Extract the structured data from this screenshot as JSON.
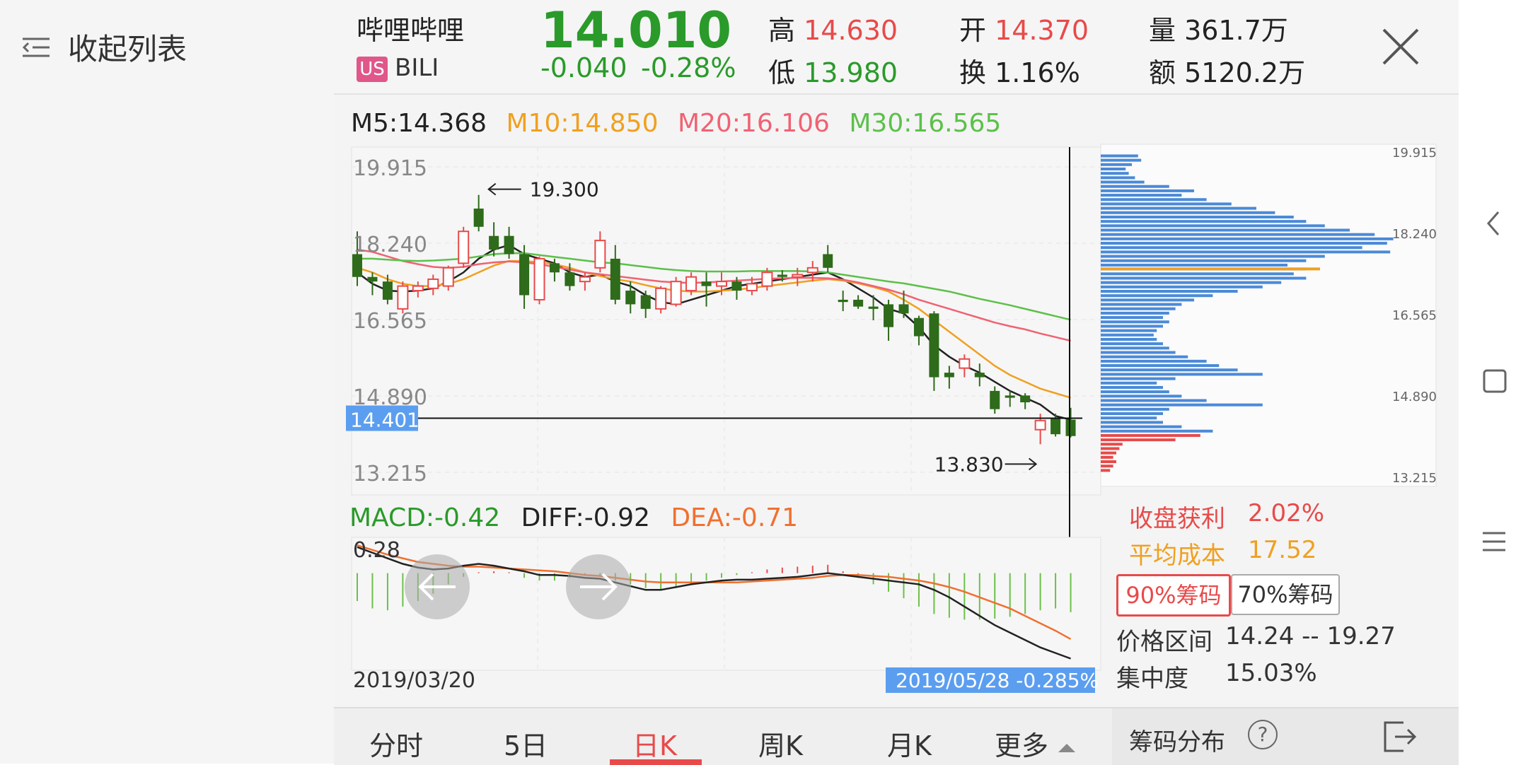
{
  "left_panel": {
    "collapse_label": "收起列表"
  },
  "stock": {
    "name": "哔哩哔哩",
    "market_badge": "US",
    "ticker": "BILI",
    "price": "14.010",
    "change": "-0.040",
    "change_pct": "-0.28%",
    "high_label": "高",
    "high": "14.630",
    "low_label": "低",
    "low": "13.980",
    "open_label": "开",
    "open": "14.370",
    "turnover_label": "换",
    "turnover": "1.16%",
    "volume_label": "量",
    "volume": "361.7万",
    "amount_label": "额",
    "amount": "5120.2万"
  },
  "ma_legend": {
    "m5": "M5:14.368",
    "m10": "M10:14.850",
    "m20": "M20:16.106",
    "m30": "M30:16.565"
  },
  "macd_legend": {
    "macd": "MACD:-0.42",
    "diff": "DIFF:-0.92",
    "dea": "DEA:-0.71"
  },
  "colors": {
    "up": "#e84a4a",
    "down": "#2e6b1a",
    "m5": "#222222",
    "m10": "#f0a020",
    "m20": "#ef6373",
    "m30": "#5cc04a",
    "chip_blue": "#4a8ad8",
    "chip_red": "#e84a4a",
    "accent": "#e84a4a"
  },
  "chart_data": [
    {
      "type": "candlestick",
      "ylim": [
        13.215,
        19.915
      ],
      "yticks": [
        "19.915",
        "18.240",
        "16.565",
        "14.890",
        "13.215"
      ],
      "crosshair_price": "14.401",
      "annotations": {
        "high": "19.300",
        "low": "13.830"
      },
      "candles": [
        [
          18.0,
          18.5,
          17.3,
          17.5
        ],
        [
          17.5,
          17.6,
          17.1,
          17.4
        ],
        [
          17.4,
          17.55,
          16.9,
          17.0
        ],
        [
          16.8,
          17.4,
          16.7,
          17.3
        ],
        [
          17.2,
          17.4,
          17.05,
          17.3
        ],
        [
          17.25,
          17.55,
          17.1,
          17.45
        ],
        [
          17.3,
          17.75,
          17.2,
          17.7
        ],
        [
          17.8,
          18.6,
          17.7,
          18.5
        ],
        [
          19.0,
          19.3,
          18.5,
          18.6
        ],
        [
          18.4,
          18.7,
          17.95,
          18.1
        ],
        [
          18.4,
          18.6,
          17.9,
          18.0
        ],
        [
          18.0,
          18.2,
          16.8,
          17.1
        ],
        [
          17.0,
          17.95,
          16.9,
          17.9
        ],
        [
          17.8,
          17.9,
          17.4,
          17.6
        ],
        [
          17.6,
          17.8,
          17.2,
          17.3
        ],
        [
          17.4,
          17.6,
          17.2,
          17.5
        ],
        [
          17.7,
          18.5,
          17.6,
          18.3
        ],
        [
          17.9,
          18.2,
          16.9,
          17.0
        ],
        [
          17.2,
          17.4,
          16.7,
          16.9
        ],
        [
          17.1,
          17.2,
          16.6,
          16.8
        ],
        [
          16.8,
          17.3,
          16.7,
          17.25
        ],
        [
          16.9,
          17.5,
          16.85,
          17.4
        ],
        [
          17.2,
          17.6,
          17.1,
          17.5
        ],
        [
          17.4,
          17.6,
          16.85,
          17.3
        ],
        [
          17.3,
          17.6,
          17.1,
          17.4
        ],
        [
          17.4,
          17.5,
          17.0,
          17.2
        ],
        [
          17.2,
          17.5,
          17.1,
          17.35
        ],
        [
          17.3,
          17.7,
          17.2,
          17.6
        ],
        [
          17.55,
          17.65,
          17.4,
          17.5
        ],
        [
          17.5,
          17.7,
          17.3,
          17.55
        ],
        [
          17.6,
          17.85,
          17.4,
          17.7
        ],
        [
          18.0,
          18.2,
          17.6,
          17.7
        ],
        [
          17.0,
          17.2,
          16.75,
          16.95
        ],
        [
          17.0,
          17.1,
          16.8,
          16.85
        ],
        [
          16.85,
          17.1,
          16.55,
          16.8
        ],
        [
          16.9,
          17.0,
          16.1,
          16.4
        ],
        [
          16.9,
          17.2,
          16.6,
          16.7
        ],
        [
          16.6,
          16.65,
          16.0,
          16.2
        ],
        [
          16.7,
          16.75,
          15.0,
          15.3
        ],
        [
          15.4,
          15.55,
          15.05,
          15.3
        ],
        [
          15.5,
          15.8,
          15.3,
          15.7
        ],
        [
          15.4,
          15.6,
          15.1,
          15.3
        ],
        [
          15.0,
          15.1,
          14.5,
          14.6
        ],
        [
          14.9,
          15.0,
          14.65,
          14.85
        ],
        [
          14.9,
          14.95,
          14.6,
          14.75
        ],
        [
          14.15,
          14.5,
          13.83,
          14.35
        ],
        [
          14.4,
          14.5,
          14.0,
          14.05
        ],
        [
          14.37,
          14.63,
          13.98,
          14.01
        ]
      ],
      "ma_lines": {
        "m5": [
          17.6,
          17.35,
          17.2,
          17.18,
          17.2,
          17.25,
          17.4,
          17.6,
          17.9,
          18.1,
          18.2,
          18.0,
          17.9,
          17.8,
          17.6,
          17.5,
          17.55,
          17.4,
          17.3,
          17.1,
          16.95,
          16.9,
          17.0,
          17.1,
          17.2,
          17.3,
          17.35,
          17.4,
          17.45,
          17.5,
          17.55,
          17.6,
          17.45,
          17.25,
          17.05,
          16.8,
          16.7,
          16.4,
          16.0,
          15.75,
          15.55,
          15.4,
          15.2,
          15.0,
          14.85,
          14.7,
          14.45,
          14.37
        ],
        "m10": [
          17.7,
          17.6,
          17.45,
          17.35,
          17.3,
          17.3,
          17.35,
          17.45,
          17.6,
          17.75,
          17.85,
          17.85,
          17.82,
          17.78,
          17.7,
          17.6,
          17.52,
          17.45,
          17.4,
          17.32,
          17.25,
          17.2,
          17.18,
          17.18,
          17.2,
          17.22,
          17.26,
          17.3,
          17.34,
          17.38,
          17.42,
          17.45,
          17.42,
          17.36,
          17.28,
          17.18,
          17.0,
          16.8,
          16.55,
          16.3,
          16.05,
          15.8,
          15.55,
          15.35,
          15.2,
          15.05,
          14.95,
          14.85
        ],
        "m20": [
          18.1,
          18.05,
          17.95,
          17.85,
          17.78,
          17.72,
          17.7,
          17.72,
          17.78,
          17.82,
          17.84,
          17.82,
          17.78,
          17.72,
          17.66,
          17.6,
          17.56,
          17.52,
          17.48,
          17.44,
          17.4,
          17.38,
          17.37,
          17.38,
          17.4,
          17.42,
          17.44,
          17.46,
          17.47,
          17.48,
          17.48,
          17.47,
          17.44,
          17.38,
          17.3,
          17.22,
          17.12,
          17.0,
          16.9,
          16.8,
          16.7,
          16.6,
          16.5,
          16.42,
          16.35,
          16.26,
          16.18,
          16.1
        ],
        "m30": [
          17.9,
          17.9,
          17.88,
          17.86,
          17.85,
          17.86,
          17.88,
          17.9,
          17.95,
          18.0,
          18.02,
          18.02,
          17.98,
          17.94,
          17.9,
          17.86,
          17.82,
          17.8,
          17.76,
          17.72,
          17.68,
          17.65,
          17.63,
          17.62,
          17.62,
          17.62,
          17.63,
          17.63,
          17.63,
          17.63,
          17.62,
          17.6,
          17.55,
          17.5,
          17.45,
          17.4,
          17.36,
          17.3,
          17.24,
          17.18,
          17.1,
          17.02,
          16.95,
          16.88,
          16.8,
          16.72,
          16.64,
          16.56
        ]
      }
    },
    {
      "type": "bar",
      "title": "MACD",
      "ytick": "0.28",
      "x_start": "2019/03/20",
      "x_end": "2019/05/28",
      "end_label": "-0.285%",
      "hist": [
        -0.3,
        -0.38,
        -0.4,
        -0.36,
        -0.3,
        -0.22,
        -0.12,
        -0.04,
        0.01,
        0.02,
        0.01,
        -0.05,
        -0.08,
        -0.08,
        -0.05,
        -0.03,
        -0.04,
        -0.08,
        -0.12,
        -0.16,
        -0.18,
        -0.16,
        -0.12,
        -0.08,
        -0.05,
        -0.02,
        0.01,
        0.04,
        0.06,
        0.07,
        0.08,
        0.09,
        0.02,
        -0.05,
        -0.12,
        -0.2,
        -0.27,
        -0.36,
        -0.44,
        -0.48,
        -0.5,
        -0.5,
        -0.49,
        -0.47,
        -0.44,
        -0.4,
        -0.38,
        -0.42
      ],
      "diff": [
        0.28,
        0.22,
        0.16,
        0.1,
        0.06,
        0.04,
        0.05,
        0.08,
        0.1,
        0.08,
        0.05,
        0.02,
        -0.02,
        -0.02,
        -0.03,
        -0.05,
        -0.06,
        -0.1,
        -0.14,
        -0.18,
        -0.18,
        -0.15,
        -0.12,
        -0.1,
        -0.08,
        -0.07,
        -0.07,
        -0.06,
        -0.05,
        -0.04,
        -0.02,
        0.0,
        -0.02,
        -0.04,
        -0.06,
        -0.08,
        -0.1,
        -0.12,
        -0.18,
        -0.26,
        -0.36,
        -0.46,
        -0.56,
        -0.64,
        -0.72,
        -0.8,
        -0.86,
        -0.92
      ],
      "dea": [
        0.3,
        0.25,
        0.2,
        0.16,
        0.12,
        0.1,
        0.08,
        0.07,
        0.07,
        0.06,
        0.05,
        0.04,
        0.03,
        0.02,
        0.0,
        -0.02,
        -0.03,
        -0.05,
        -0.07,
        -0.09,
        -0.1,
        -0.1,
        -0.1,
        -0.1,
        -0.1,
        -0.1,
        -0.09,
        -0.08,
        -0.07,
        -0.06,
        -0.05,
        -0.03,
        -0.02,
        -0.02,
        -0.03,
        -0.04,
        -0.06,
        -0.08,
        -0.11,
        -0.15,
        -0.2,
        -0.26,
        -0.32,
        -0.38,
        -0.46,
        -0.54,
        -0.62,
        -0.71
      ]
    },
    {
      "type": "horizontal-bar",
      "title": "筹码分布",
      "price_ticks": [
        "19.915",
        "18.240",
        "16.565",
        "14.890",
        "13.215"
      ],
      "ylim": [
        13.215,
        19.915
      ],
      "avg_cost": 17.52,
      "bins": [
        [
          19.85,
          0.12
        ],
        [
          19.76,
          0.13
        ],
        [
          19.67,
          0.1
        ],
        [
          19.58,
          0.08
        ],
        [
          19.49,
          0.09
        ],
        [
          19.4,
          0.11
        ],
        [
          19.31,
          0.14
        ],
        [
          19.22,
          0.22
        ],
        [
          19.13,
          0.3
        ],
        [
          19.04,
          0.26
        ],
        [
          18.95,
          0.34
        ],
        [
          18.86,
          0.42
        ],
        [
          18.77,
          0.5
        ],
        [
          18.68,
          0.56
        ],
        [
          18.59,
          0.62
        ],
        [
          18.5,
          0.66
        ],
        [
          18.41,
          0.72
        ],
        [
          18.32,
          0.8
        ],
        [
          18.23,
          0.88
        ],
        [
          18.14,
          0.94
        ],
        [
          18.05,
          0.92
        ],
        [
          17.96,
          0.84
        ],
        [
          17.87,
          0.93
        ],
        [
          17.78,
          0.72
        ],
        [
          17.69,
          0.66
        ],
        [
          17.6,
          0.6
        ],
        [
          17.52,
          0.66
        ],
        [
          17.42,
          0.62
        ],
        [
          17.33,
          0.66
        ],
        [
          17.24,
          0.58
        ],
        [
          17.15,
          0.52
        ],
        [
          17.06,
          0.44
        ],
        [
          16.97,
          0.36
        ],
        [
          16.88,
          0.3
        ],
        [
          16.79,
          0.26
        ],
        [
          16.7,
          0.24
        ],
        [
          16.61,
          0.22
        ],
        [
          16.52,
          0.2
        ],
        [
          16.43,
          0.22
        ],
        [
          16.34,
          0.2
        ],
        [
          16.25,
          0.18
        ],
        [
          16.16,
          0.17
        ],
        [
          16.07,
          0.18
        ],
        [
          15.98,
          0.2
        ],
        [
          15.89,
          0.22
        ],
        [
          15.8,
          0.24
        ],
        [
          15.71,
          0.28
        ],
        [
          15.62,
          0.34
        ],
        [
          15.53,
          0.38
        ],
        [
          15.44,
          0.44
        ],
        [
          15.35,
          0.52
        ],
        [
          15.26,
          0.24
        ],
        [
          15.17,
          0.18
        ],
        [
          15.08,
          0.2
        ],
        [
          14.99,
          0.22
        ],
        [
          14.9,
          0.26
        ],
        [
          14.81,
          0.34
        ],
        [
          14.72,
          0.52
        ],
        [
          14.63,
          0.22
        ],
        [
          14.54,
          0.2
        ],
        [
          14.45,
          0.18
        ],
        [
          14.36,
          0.2
        ],
        [
          14.27,
          0.26
        ],
        [
          14.18,
          0.36
        ],
        [
          14.09,
          0.32
        ],
        [
          14.0,
          0.24
        ],
        [
          13.91,
          0.07
        ],
        [
          13.82,
          0.06
        ],
        [
          13.73,
          0.05
        ],
        [
          13.64,
          0.04
        ],
        [
          13.55,
          0.05
        ],
        [
          13.46,
          0.04
        ],
        [
          13.37,
          0.03
        ]
      ]
    }
  ],
  "chip_stats": {
    "profit_label": "收盘获利",
    "profit_value": "2.02%",
    "avg_label": "平均成本",
    "avg_value": "17.52",
    "btn90": "90%筹码",
    "btn70": "70%筹码",
    "range_label": "价格区间",
    "range_value": "14.24 -- 19.27",
    "conc_label": "集中度",
    "conc_value": "15.03%"
  },
  "tabs": [
    "分时",
    "5日",
    "日K",
    "周K",
    "月K",
    "更多"
  ],
  "active_tab": "日K",
  "chip_bar": {
    "label": "筹码分布",
    "help": "?"
  }
}
